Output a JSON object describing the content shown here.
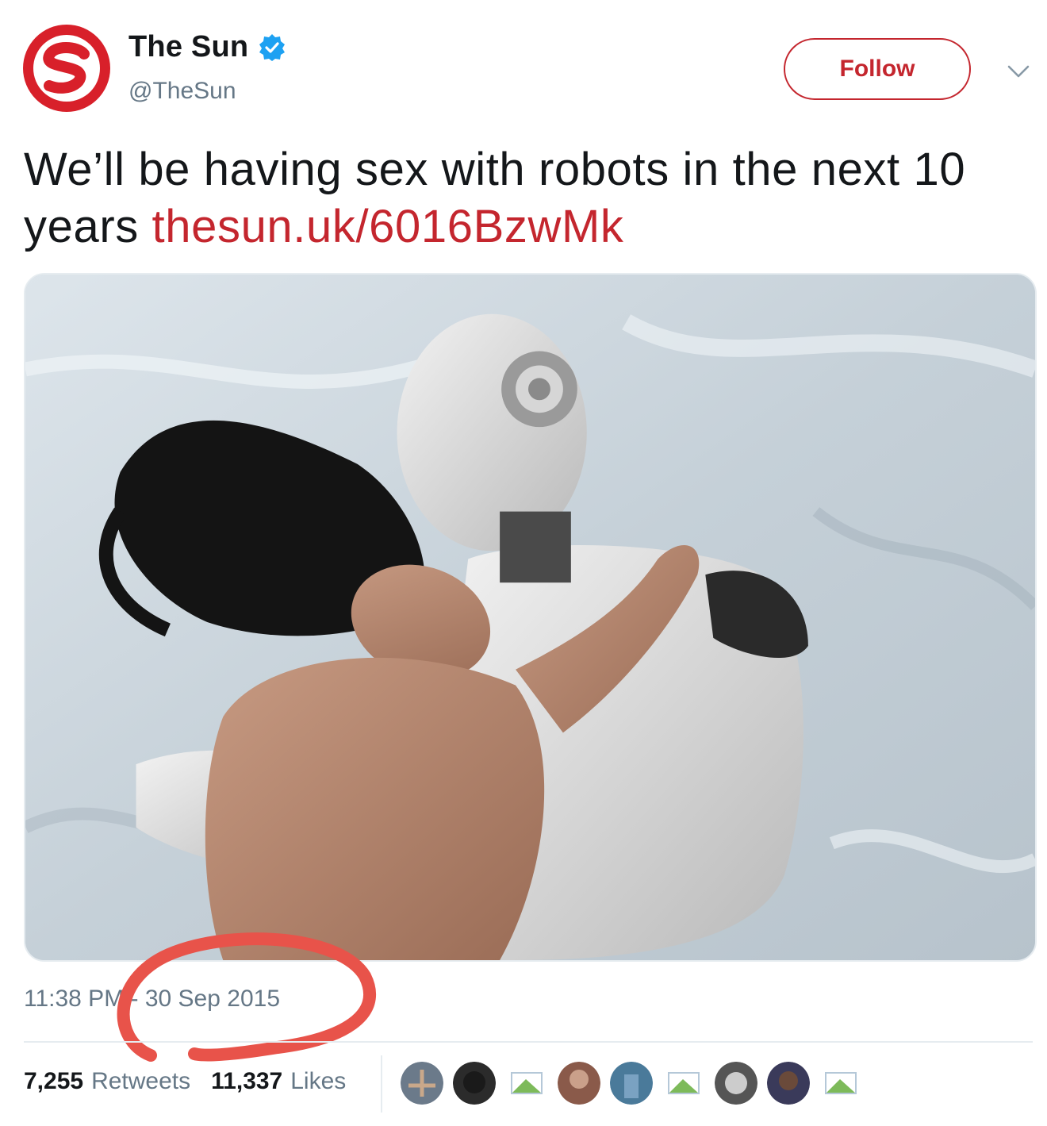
{
  "account": {
    "display_name": "The Sun",
    "handle": "@TheSun",
    "verified": true,
    "avatar_icon": "the-sun-logo-icon",
    "brand_color": "#c4262e"
  },
  "follow_button": {
    "label": "Follow"
  },
  "tweet": {
    "text": "We’ll be having sex with robots in the next 10 years ",
    "link": "thesun.uk/6016BzwMk",
    "media_description_icon": "tweet-photo",
    "timestamp": "11:38 PM - 30 Sep 2015"
  },
  "stats": {
    "retweets_count": "7,255",
    "retweets_label": "Retweets",
    "likes_count": "11,337",
    "likes_label": "Likes"
  },
  "likers": [
    {
      "icon": "liker-avatar-1",
      "color": "#6b7a8a"
    },
    {
      "icon": "liker-avatar-2",
      "color": "#2b2b2b"
    },
    {
      "icon": "liker-avatar-3",
      "color": "#7dba5a"
    },
    {
      "icon": "liker-avatar-4",
      "color": "#8a5a4a"
    },
    {
      "icon": "liker-avatar-5",
      "color": "#4a7a9a"
    },
    {
      "icon": "liker-avatar-6",
      "color": "#7dba5a"
    },
    {
      "icon": "liker-avatar-7",
      "color": "#555555"
    },
    {
      "icon": "liker-avatar-8",
      "color": "#3a3a5a"
    },
    {
      "icon": "liker-avatar-9",
      "color": "#7dba5a"
    }
  ],
  "colors": {
    "text": "#14171a",
    "secondary": "#657786",
    "link": "#c4262e",
    "annotation": "#e8534a"
  }
}
